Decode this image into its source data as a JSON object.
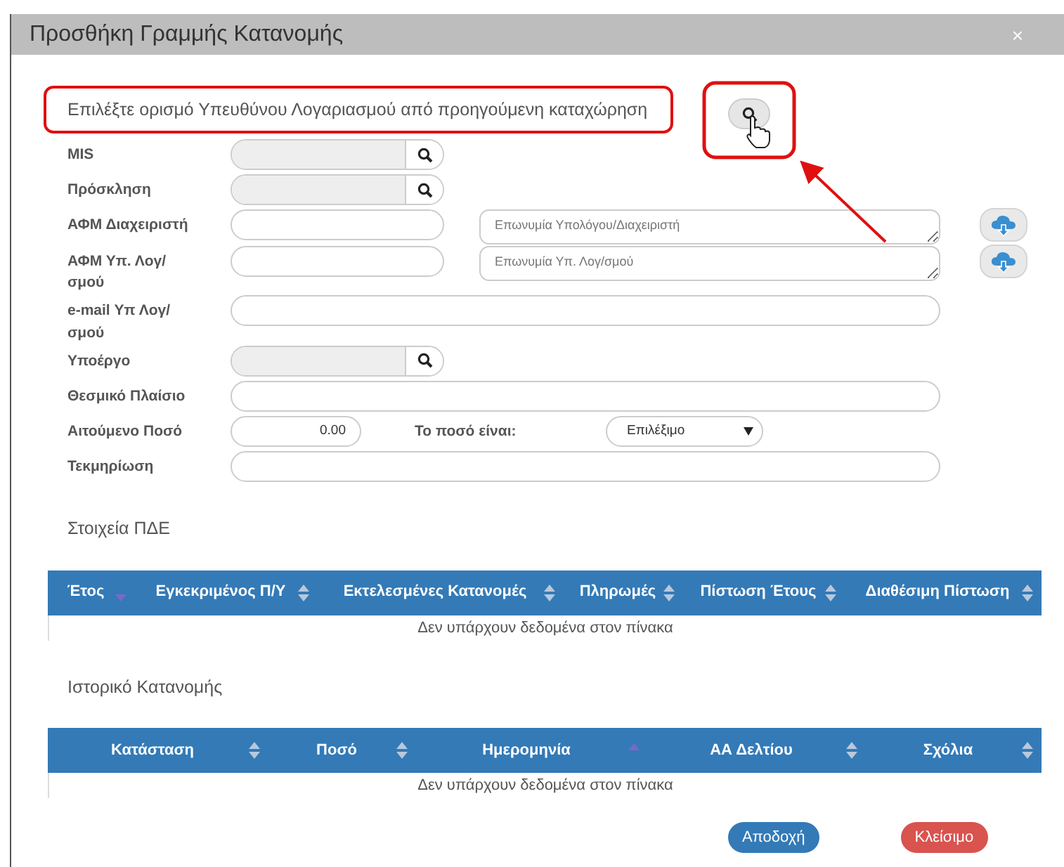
{
  "dialog": {
    "title": "Προσθήκη Γραμμής Κατανομής",
    "close": "×"
  },
  "instruction": "Επιλέξτε ορισμό Υπευθύνου Λογαριασμού από προηγούμενη καταχώρηση",
  "form_rows": [
    {
      "label": "MIS",
      "fields": [
        {
          "kind": "lookup",
          "disabled": true
        }
      ]
    },
    {
      "label": "Πρόσκληση",
      "fields": [
        {
          "kind": "lookup",
          "disabled": true
        }
      ]
    },
    {
      "label": "ΑΦΜ Διαχειριστή",
      "fields": [
        {
          "kind": "text"
        },
        {
          "kind": "textarea",
          "placeholder": "Επωνυμία Υπολόγου/Διαχειριστή"
        },
        {
          "kind": "cloud"
        }
      ]
    },
    {
      "label": "ΑΦΜ Υπ. Λογ/σμού",
      "fields": [
        {
          "kind": "text"
        },
        {
          "kind": "textarea",
          "placeholder": "Επωνυμία Υπ. Λογ/σμού"
        },
        {
          "kind": "cloud"
        }
      ]
    },
    {
      "label": "e-mail Υπ Λογ/σμού",
      "fields": [
        {
          "kind": "wide"
        }
      ]
    },
    {
      "label": "Υποέργο",
      "fields": [
        {
          "kind": "lookup",
          "disabled": true
        }
      ]
    },
    {
      "label": "Θεσμικό Πλαίσιο",
      "fields": [
        {
          "kind": "wide"
        }
      ]
    },
    {
      "label": "Αιτούμενο Ποσό",
      "fields": [
        {
          "kind": "amount",
          "value": "0.00"
        },
        {
          "kind": "inline-label",
          "text": "Το ποσό είναι:"
        },
        {
          "kind": "select",
          "value": "Επιλέξιμο"
        }
      ]
    },
    {
      "label": "Τεκμηρίωση",
      "fields": [
        {
          "kind": "wide"
        }
      ]
    }
  ],
  "tables": [
    {
      "title": "Στοιχεία ΠΔΕ",
      "columns": [
        {
          "label": "Έτος",
          "sorted_ascending": false,
          "sorted_descending": true
        },
        {
          "label": "Εγκεκριμένος Π/Υ",
          "sorted_ascending": false,
          "sorted_descending": false
        },
        {
          "label": "Εκτελεσμένες Κατανομές",
          "sorted_ascending": false,
          "sorted_descending": false
        },
        {
          "label": "Πληρωμές",
          "sorted_ascending": false,
          "sorted_descending": false
        },
        {
          "label": "Πίστωση Έτους",
          "sorted_ascending": false,
          "sorted_descending": false
        },
        {
          "label": "Διαθέσιμη Πίστωση",
          "sorted_ascending": false,
          "sorted_descending": false
        }
      ],
      "empty_message": "Δεν υπάρχουν δεδομένα στον πίνακα"
    },
    {
      "title": "Ιστορικό Κατανομής",
      "columns": [
        {
          "label": "Κατάσταση",
          "sorted_ascending": false,
          "sorted_descending": false
        },
        {
          "label": "Ποσό",
          "sorted_ascending": false,
          "sorted_descending": false
        },
        {
          "label": "Ημερομηνία",
          "sorted_ascending": true,
          "sorted_descending": false
        },
        {
          "label": "ΑΑ Δελτίου",
          "sorted_ascending": false,
          "sorted_descending": false
        },
        {
          "label": "Σχόλια",
          "sorted_ascending": false,
          "sorted_descending": false
        }
      ],
      "empty_message": "Δεν υπάρχουν δεδομένα στον πίνακα"
    }
  ],
  "buttons": [
    {
      "label": "Αποδοχή",
      "kind": "primary"
    },
    {
      "label": "Κλείσιμο",
      "kind": "danger"
    }
  ]
}
